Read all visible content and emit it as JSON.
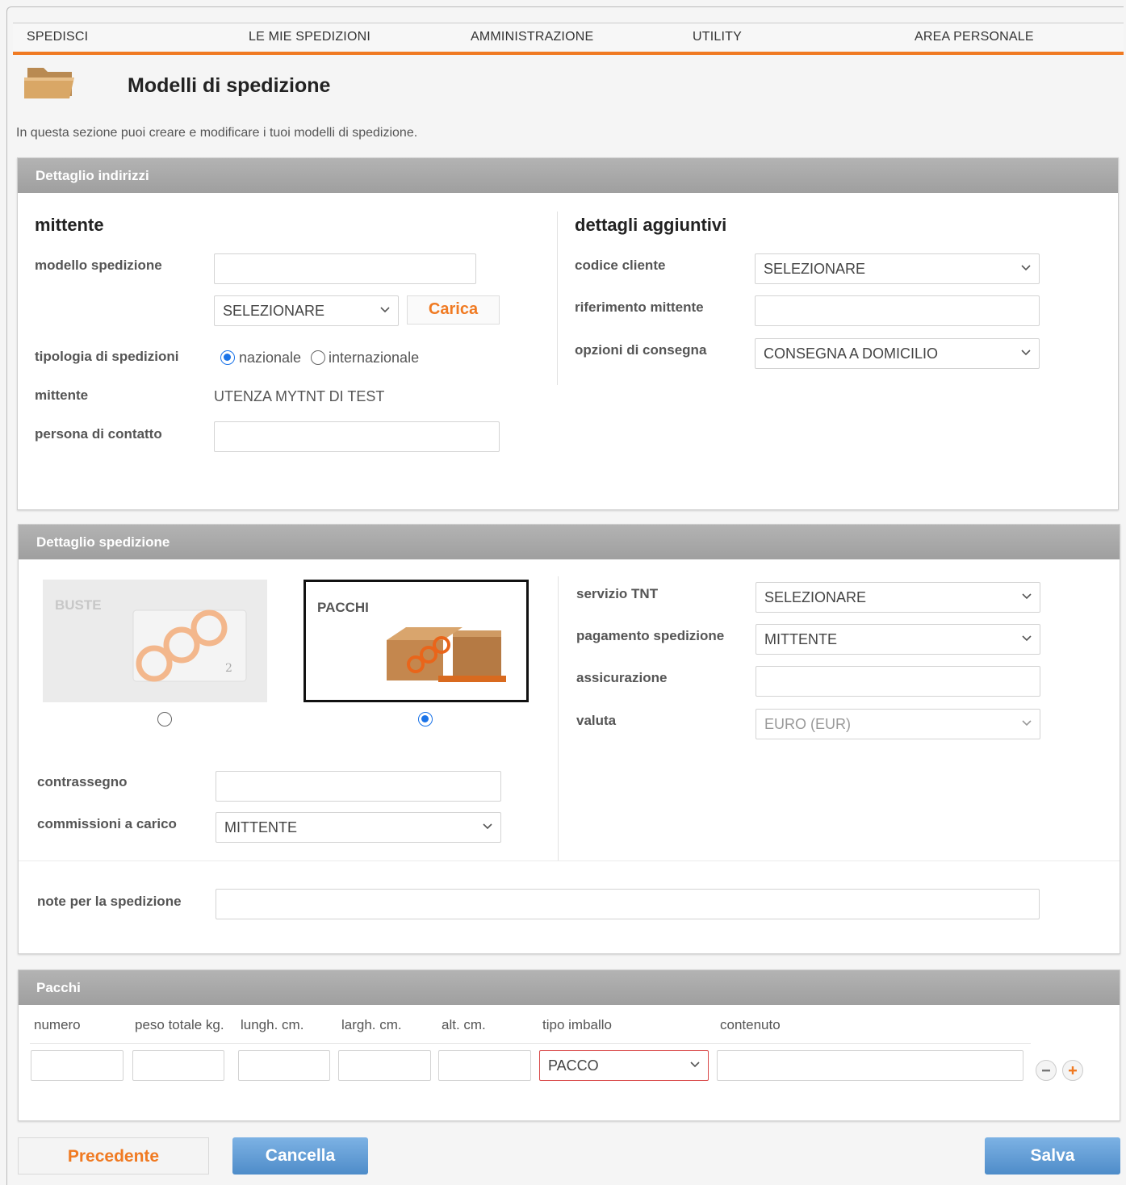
{
  "nav": {
    "items": [
      "SPEDISCI",
      "LE MIE SPEDIZIONI",
      "AMMINISTRAZIONE",
      "UTILITY",
      "AREA PERSONALE"
    ]
  },
  "header": {
    "title": "Modelli di spedizione",
    "intro": "In questa sezione puoi creare e modificare i tuoi modelli di spedizione."
  },
  "indirizzi": {
    "header": "Dettaglio indirizzi",
    "mittente_title": "mittente",
    "modello_label": "modello spedizione",
    "modello_value": "",
    "modello_select": "SELEZIONARE",
    "carica_label": "Carica",
    "tipologia_label": "tipologia di spedizioni",
    "radio_nazionale": "nazionale",
    "radio_internazionale": "internazionale",
    "tipologia_selected": "nazionale",
    "mittente_label": "mittente",
    "mittente_value": "UTENZA MYTNT DI TEST",
    "contatto_label": "persona di contatto",
    "contatto_value": "",
    "dettagli_title": "dettagli aggiuntivi",
    "codice_label": "codice cliente",
    "codice_select": "SELEZIONARE",
    "riferimento_label": "riferimento mittente",
    "riferimento_value": "",
    "opzioni_label": "opzioni di consegna",
    "opzioni_select": "CONSEGNA A DOMICILIO"
  },
  "spedizione": {
    "header": "Dettaglio spedizione",
    "card_buste": "BUSTE",
    "card_pacchi": "PACCHI",
    "selected_card": "PACCHI",
    "contrassegno_label": "contrassegno",
    "contrassegno_value": "",
    "commissioni_label": "commissioni a carico",
    "commissioni_select": "MITTENTE",
    "servizio_label": "servizio TNT",
    "servizio_select": "SELEZIONARE",
    "pagamento_label": "pagamento spedizione",
    "pagamento_select": "MITTENTE",
    "assicurazione_label": "assicurazione",
    "assicurazione_value": "",
    "valuta_label": "valuta",
    "valuta_select": "EURO (EUR)",
    "note_label": "note per la spedizione",
    "note_value": ""
  },
  "pacchi": {
    "header": "Pacchi",
    "columns": [
      "numero",
      "peso totale kg.",
      "lungh. cm.",
      "largh. cm.",
      "alt. cm.",
      "tipo imballo",
      "contenuto"
    ],
    "tipo_imballo_select": "PACCO"
  },
  "footer": {
    "precedente": "Precedente",
    "cancella": "Cancella",
    "salva": "Salva"
  },
  "colors": {
    "accent": "#f07a22",
    "panel_header": "#a9a9a9",
    "primary_button": "#5b9bd5",
    "radio_selected": "#1a73e8"
  }
}
